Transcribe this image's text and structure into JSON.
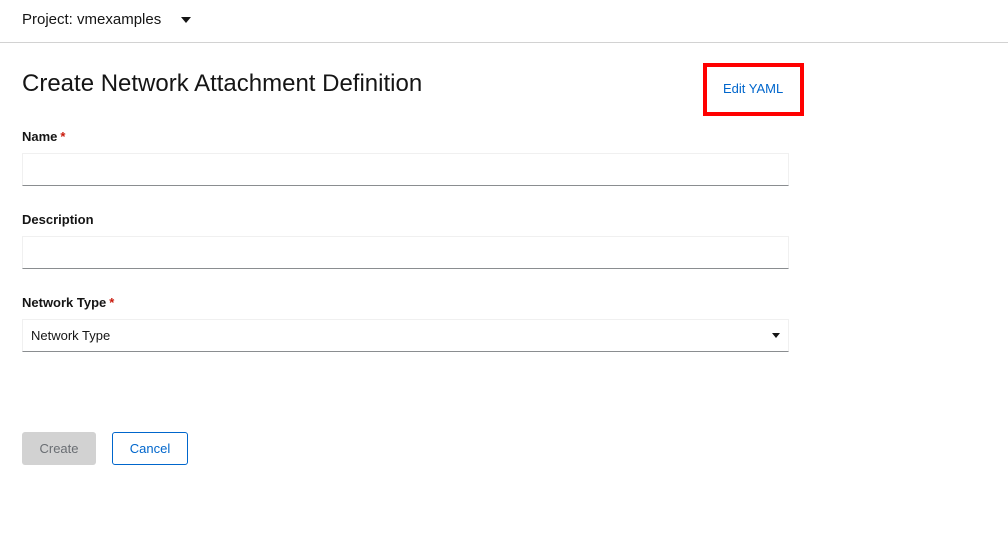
{
  "header": {
    "project_label": "Project: vmexamples"
  },
  "page": {
    "title": "Create Network Attachment Definition",
    "edit_yaml": "Edit YAML"
  },
  "form": {
    "name": {
      "label": "Name",
      "required": "*",
      "value": ""
    },
    "description": {
      "label": "Description",
      "value": ""
    },
    "network_type": {
      "label": "Network Type",
      "required": "*",
      "selected": "Network Type"
    }
  },
  "actions": {
    "create": "Create",
    "cancel": "Cancel"
  },
  "colors": {
    "link": "#0066cc",
    "required": "#c9190b",
    "highlight": "#ff0000"
  }
}
